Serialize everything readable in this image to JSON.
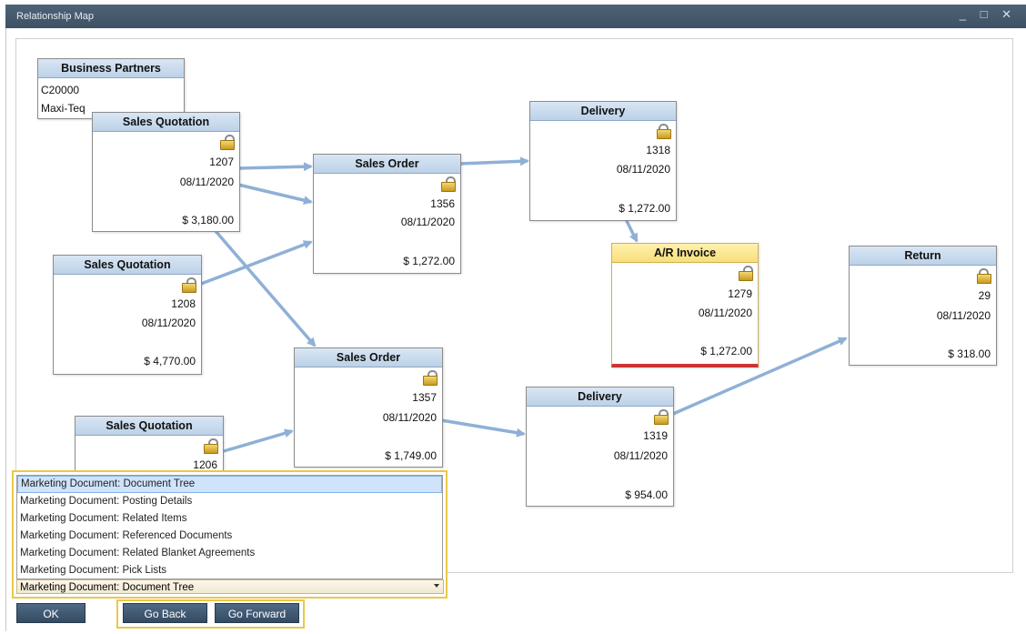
{
  "window": {
    "title": "Relationship Map",
    "controls": "_ □ ✕"
  },
  "business_partner": {
    "title": "Business Partners",
    "code": "C20000",
    "name": "Maxi-Teq"
  },
  "documents": {
    "sq1": {
      "title": "Sales Quotation",
      "number": "1207",
      "date": "08/11/2020",
      "amount": "$ 3,180.00"
    },
    "sq2": {
      "title": "Sales Quotation",
      "number": "1208",
      "date": "08/11/2020",
      "amount": "$ 4,770.00"
    },
    "sq3": {
      "title": "Sales Quotation",
      "number": "1206"
    },
    "so1": {
      "title": "Sales Order",
      "number": "1356",
      "date": "08/11/2020",
      "amount": "$ 1,272.00"
    },
    "so2": {
      "title": "Sales Order",
      "number": "1357",
      "date": "08/11/2020",
      "amount": "$ 1,749.00"
    },
    "del1": {
      "title": "Delivery",
      "number": "1318",
      "date": "08/11/2020",
      "amount": "$ 1,272.00"
    },
    "del2": {
      "title": "Delivery",
      "number": "1319",
      "date": "08/11/2020",
      "amount": "$ 954.00"
    },
    "inv": {
      "title": "A/R Invoice",
      "number": "1279",
      "date": "08/11/2020",
      "amount": "$ 1,272.00"
    },
    "ret": {
      "title": "Return",
      "number": "29",
      "date": "08/11/2020",
      "amount": "$ 318.00"
    }
  },
  "icons": {
    "lock_open": "unlocked-lock-icon",
    "lock_closed": "locked-lock-icon"
  },
  "colors": {
    "header_blue": "#c7d8ec",
    "invoice_yellow": "#fbe892",
    "invoice_bar": "#cc3333",
    "arrow": "#8fb0d6",
    "highlight": "#e9c84a"
  },
  "view_list": {
    "items": [
      "Marketing Document: Document Tree",
      "Marketing Document: Posting Details",
      "Marketing Document: Related Items",
      "Marketing Document: Referenced Documents",
      "Marketing Document: Related Blanket Agreements",
      "Marketing Document: Pick Lists"
    ],
    "selected": "Marketing Document: Document Tree"
  },
  "buttons": {
    "ok": "OK",
    "go_back": "Go Back",
    "go_forward": "Go Forward"
  }
}
